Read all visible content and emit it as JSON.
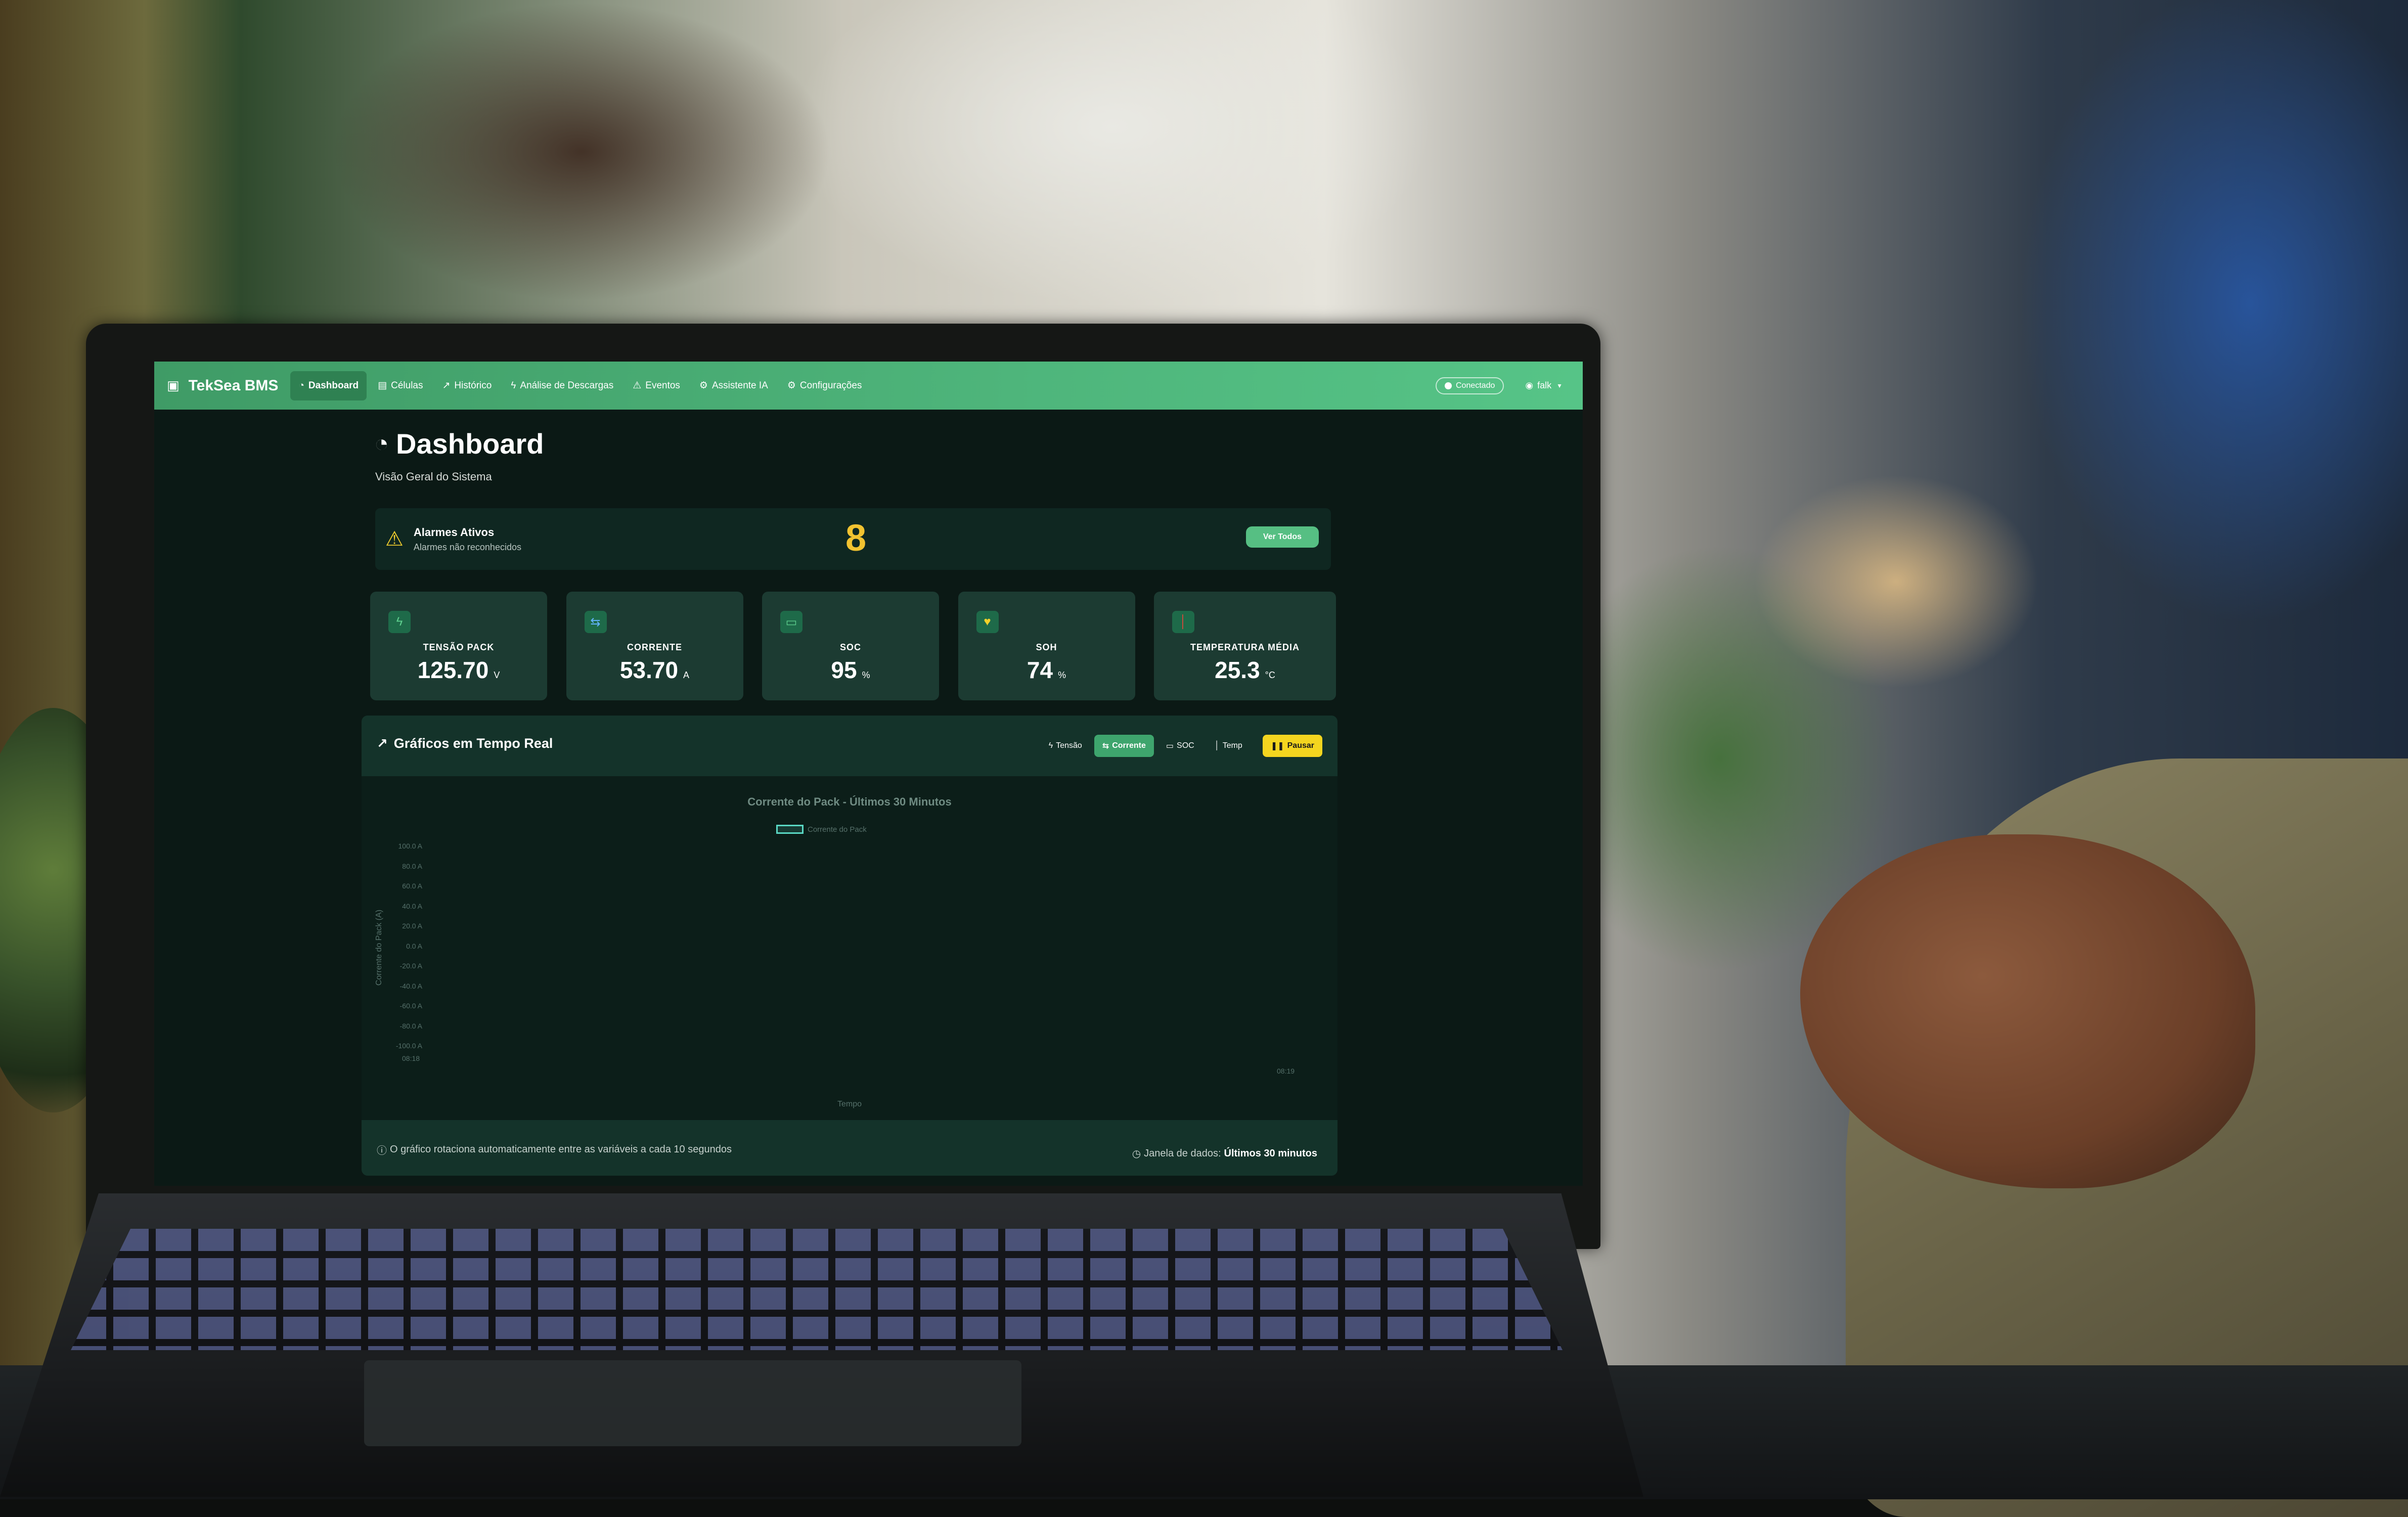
{
  "navbar": {
    "brand": "TekSea BMS",
    "items": [
      {
        "label": "Dashboard",
        "icon": "◔",
        "active": true
      },
      {
        "label": "Células",
        "icon": "▤",
        "active": false
      },
      {
        "label": "Histórico",
        "icon": "↗",
        "active": false
      },
      {
        "label": "Análise de Descargas",
        "icon": "ϟ",
        "active": false
      },
      {
        "label": "Eventos",
        "icon": "⚠",
        "active": false
      },
      {
        "label": "Assistente IA",
        "icon": "⚙",
        "active": false
      },
      {
        "label": "Configurações",
        "icon": "⚙",
        "active": false
      }
    ],
    "connection": "Conectado",
    "user": "falk"
  },
  "page": {
    "title": "Dashboard",
    "subtitle": "Visão Geral do Sistema"
  },
  "alarms": {
    "title": "Alarmes Ativos",
    "subtitle": "Alarmes não reconhecidos",
    "count": "8",
    "view_all": "Ver Todos"
  },
  "metrics": [
    {
      "label": "TENSÃO PACK",
      "value": "125.70",
      "unit": "V",
      "icon": "ϟ",
      "icon_color": "#5fd08f"
    },
    {
      "label": "CORRENTE",
      "value": "53.70",
      "unit": "A",
      "icon": "⇆",
      "icon_color": "#63b4ff"
    },
    {
      "label": "SOC",
      "value": "95",
      "unit": "%",
      "icon": "▭",
      "icon_color": "#5fd08f"
    },
    {
      "label": "SOH",
      "value": "74",
      "unit": "%",
      "icon": "♥",
      "icon_color": "#f2d12a"
    },
    {
      "label": "TEMPERATURA MÉDIA",
      "value": "25.3",
      "unit": "°C",
      "icon": "│",
      "icon_color": "#e2463a"
    }
  ],
  "charts": {
    "title": "Gráficos em Tempo Real",
    "buttons": {
      "tensao": "Tensão",
      "corrente": "Corrente",
      "soc": "SOC",
      "temp": "Temp",
      "pause": "Pausar"
    },
    "footer_note": "O gráfico rotaciona automaticamente entre as variáveis a cada 10 segundos",
    "window_label": "Janela de dados:",
    "window_value": "Últimos 30 minutos"
  },
  "chart_data": {
    "type": "line",
    "title": "Corrente do Pack - Últimos 30 Minutos",
    "xlabel": "Tempo",
    "ylabel": "Corrente do Pack (A)",
    "series": [
      {
        "name": "Corrente do Pack",
        "values": []
      }
    ],
    "ylim": [
      -100,
      100
    ],
    "yticks": [
      "100.0 A",
      "80.0 A",
      "60.0 A",
      "40.0 A",
      "20.0 A",
      "0.0 A",
      "-20.0 A",
      "-40.0 A",
      "-60.0 A",
      "-80.0 A",
      "-100.0 A"
    ],
    "xticks": [
      "08:18",
      "08:19"
    ],
    "legend": "top",
    "colors": {
      "line": "#5ad8c4"
    }
  }
}
